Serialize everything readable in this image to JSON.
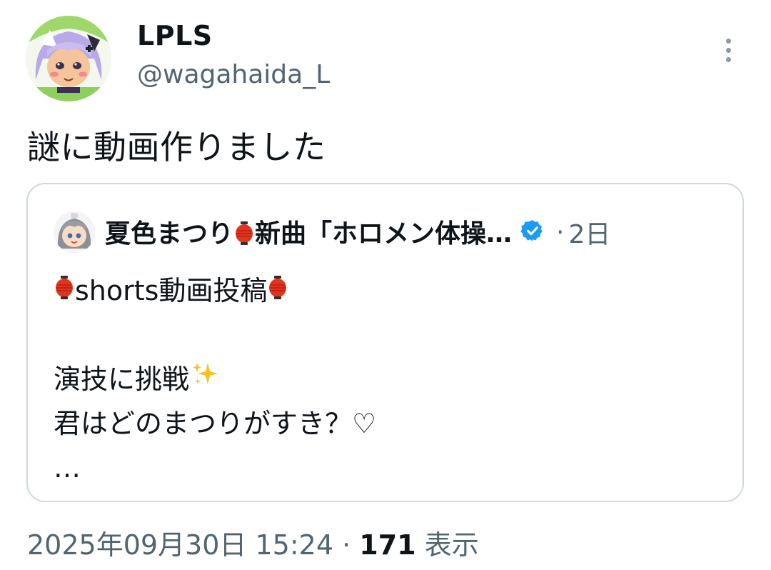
{
  "author": {
    "display_name": "LPLS",
    "handle": "@wagahaida_L",
    "avatar_icon": "anime-avatar-icon"
  },
  "more_icon": "more-vertical-icon",
  "tweet": {
    "text": "謎に動画作りました"
  },
  "quote": {
    "name_part1": "夏色まつり",
    "name_part2": "新曲「ホロメン体操…",
    "verified_icon": "verified-badge-icon",
    "separator": "·",
    "time": "2日",
    "line1_text": "shorts動画投稿",
    "line2_text": "演技に挑戦",
    "line3_text": "君はどのまつりがすき？♡",
    "ellipsis": "…",
    "lantern_icon": "red-lantern-icon",
    "sparkle_icon": "sparkles-icon"
  },
  "footer": {
    "timestamp": "2025年09月30日 15:24",
    "separator": "·",
    "views_count": "171",
    "views_label": "表示"
  },
  "colors": {
    "text_primary": "#0f1419",
    "text_secondary": "#536471",
    "border": "#cfd9de",
    "verified_blue": "#1d9bf0",
    "lantern_red": "#e0341e"
  }
}
